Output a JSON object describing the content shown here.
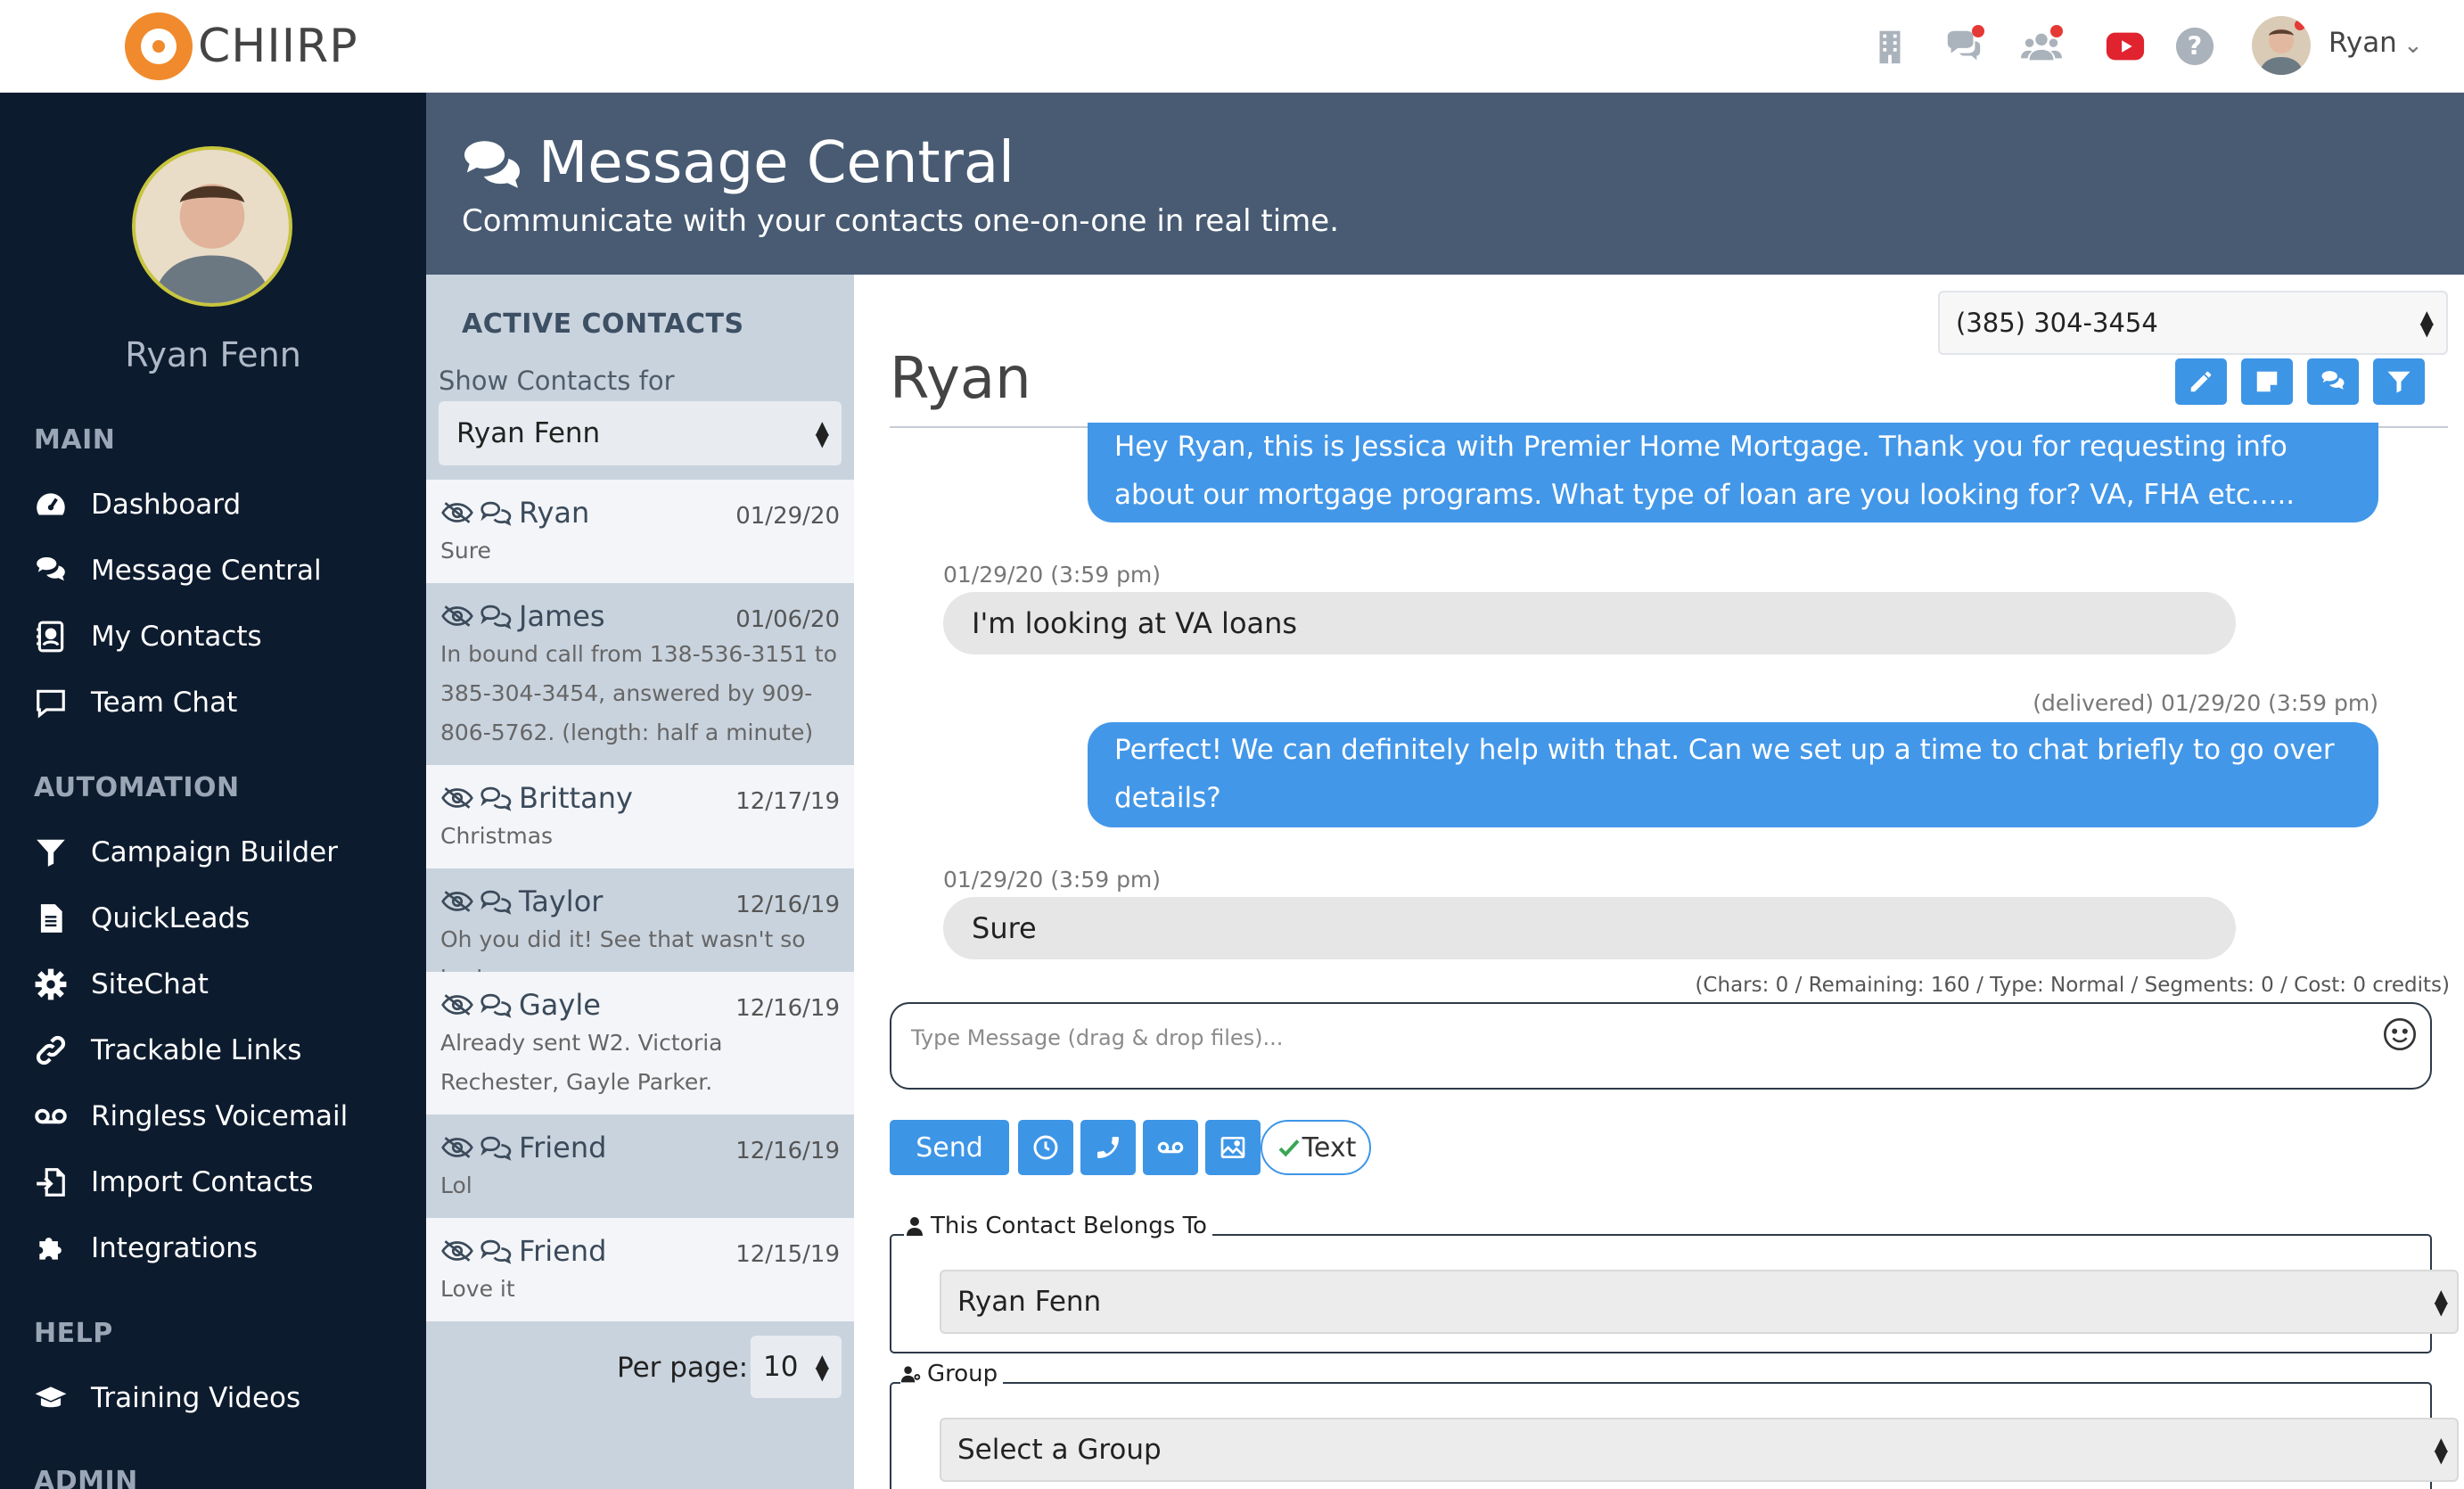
{
  "topbar": {
    "brand": "CHIIRP",
    "user": "Ryan",
    "icons": [
      "building-icon",
      "chat-icon",
      "team-icon",
      "youtube-icon",
      "help-icon"
    ]
  },
  "sidebar": {
    "profile_name": "Ryan Fenn",
    "sections": {
      "main": "MAIN",
      "automation": "AUTOMATION",
      "help": "HELP",
      "admin": "ADMIN"
    },
    "main_items": [
      {
        "label": "Dashboard",
        "icon": "dashboard-icon"
      },
      {
        "label": "Message Central",
        "icon": "comments-icon"
      },
      {
        "label": "My Contacts",
        "icon": "contacts-icon"
      },
      {
        "label": "Team Chat",
        "icon": "chat-bubble-icon"
      }
    ],
    "automation_items": [
      {
        "label": "Campaign Builder",
        "icon": "filter-icon"
      },
      {
        "label": "QuickLeads",
        "icon": "document-icon"
      },
      {
        "label": "SiteChat",
        "icon": "gear-icon"
      },
      {
        "label": "Trackable Links",
        "icon": "link-icon"
      },
      {
        "label": "Ringless Voicemail",
        "icon": "voicemail-icon"
      },
      {
        "label": "Import Contacts",
        "icon": "import-icon"
      },
      {
        "label": "Integrations",
        "icon": "puzzle-icon"
      }
    ],
    "help_items": [
      {
        "label": "Training Videos",
        "icon": "graduation-cap-icon"
      }
    ]
  },
  "header": {
    "title": "Message Central",
    "subtitle": "Communicate with your contacts one-on-one in real time."
  },
  "contacts": {
    "title": "ACTIVE CONTACTS",
    "show_for_label": "Show Contacts for",
    "show_for_value": "Ryan Fenn",
    "items": [
      {
        "name": "Ryan",
        "date": "01/29/20",
        "preview": "Sure"
      },
      {
        "name": "James",
        "date": "01/06/20",
        "preview": "In bound call from 138-536-3151 to 385-304-3454, answered by 909-806-5762. (length: half a minute)"
      },
      {
        "name": "Brittany",
        "date": "12/17/19",
        "preview": "Christmas"
      },
      {
        "name": "Taylor",
        "date": "12/16/19",
        "preview": "Oh you did it! See that wasn't so bad"
      },
      {
        "name": "Gayle",
        "date": "12/16/19",
        "preview": "Already sent W2. Victoria Rechester, Gayle Parker."
      },
      {
        "name": "Friend",
        "date": "12/16/19",
        "preview": "Lol"
      },
      {
        "name": "Friend",
        "date": "12/15/19",
        "preview": "Love it"
      }
    ],
    "per_page_label": "Per page:",
    "per_page_value": "10"
  },
  "conversation": {
    "phone": "(385) 304-3454",
    "contact_name": "Ryan",
    "messages": [
      {
        "direction": "out",
        "text": "Hey Ryan, this is Jessica with Premier Home Mortgage. Thank you for requesting info about our mortgage programs. What type of loan are you looking for? VA, FHA etc....."
      },
      {
        "direction": "in",
        "meta": "01/29/20 (3:59 pm)",
        "text": "I'm looking at VA loans"
      },
      {
        "direction": "out",
        "meta": "(delivered) 01/29/20 (3:59 pm)",
        "text": "Perfect! We can definitely help with that. Can we set up a time to chat briefly to go over details?"
      },
      {
        "direction": "in",
        "meta": "01/29/20 (3:59 pm)",
        "text": "Sure"
      }
    ],
    "chars_info": "(Chars: 0 / Remaining: 160 / Type: Normal / Segments: 0 / Cost: 0 credits)",
    "input_placeholder": "Type Message (drag & drop files)...",
    "send_label": "Send",
    "text_toggle_label": "Text",
    "belongs_label": "This Contact Belongs To",
    "belongs_value": "Ryan Fenn",
    "group_label": "Group",
    "group_value": "Select a Group"
  },
  "colors": {
    "sidebar_bg": "#0d1b2e",
    "header_bg": "#485b73",
    "accent": "#3d95e6",
    "contacts_panel": "#c9d3de",
    "logo_orange": "#f08a2c"
  }
}
